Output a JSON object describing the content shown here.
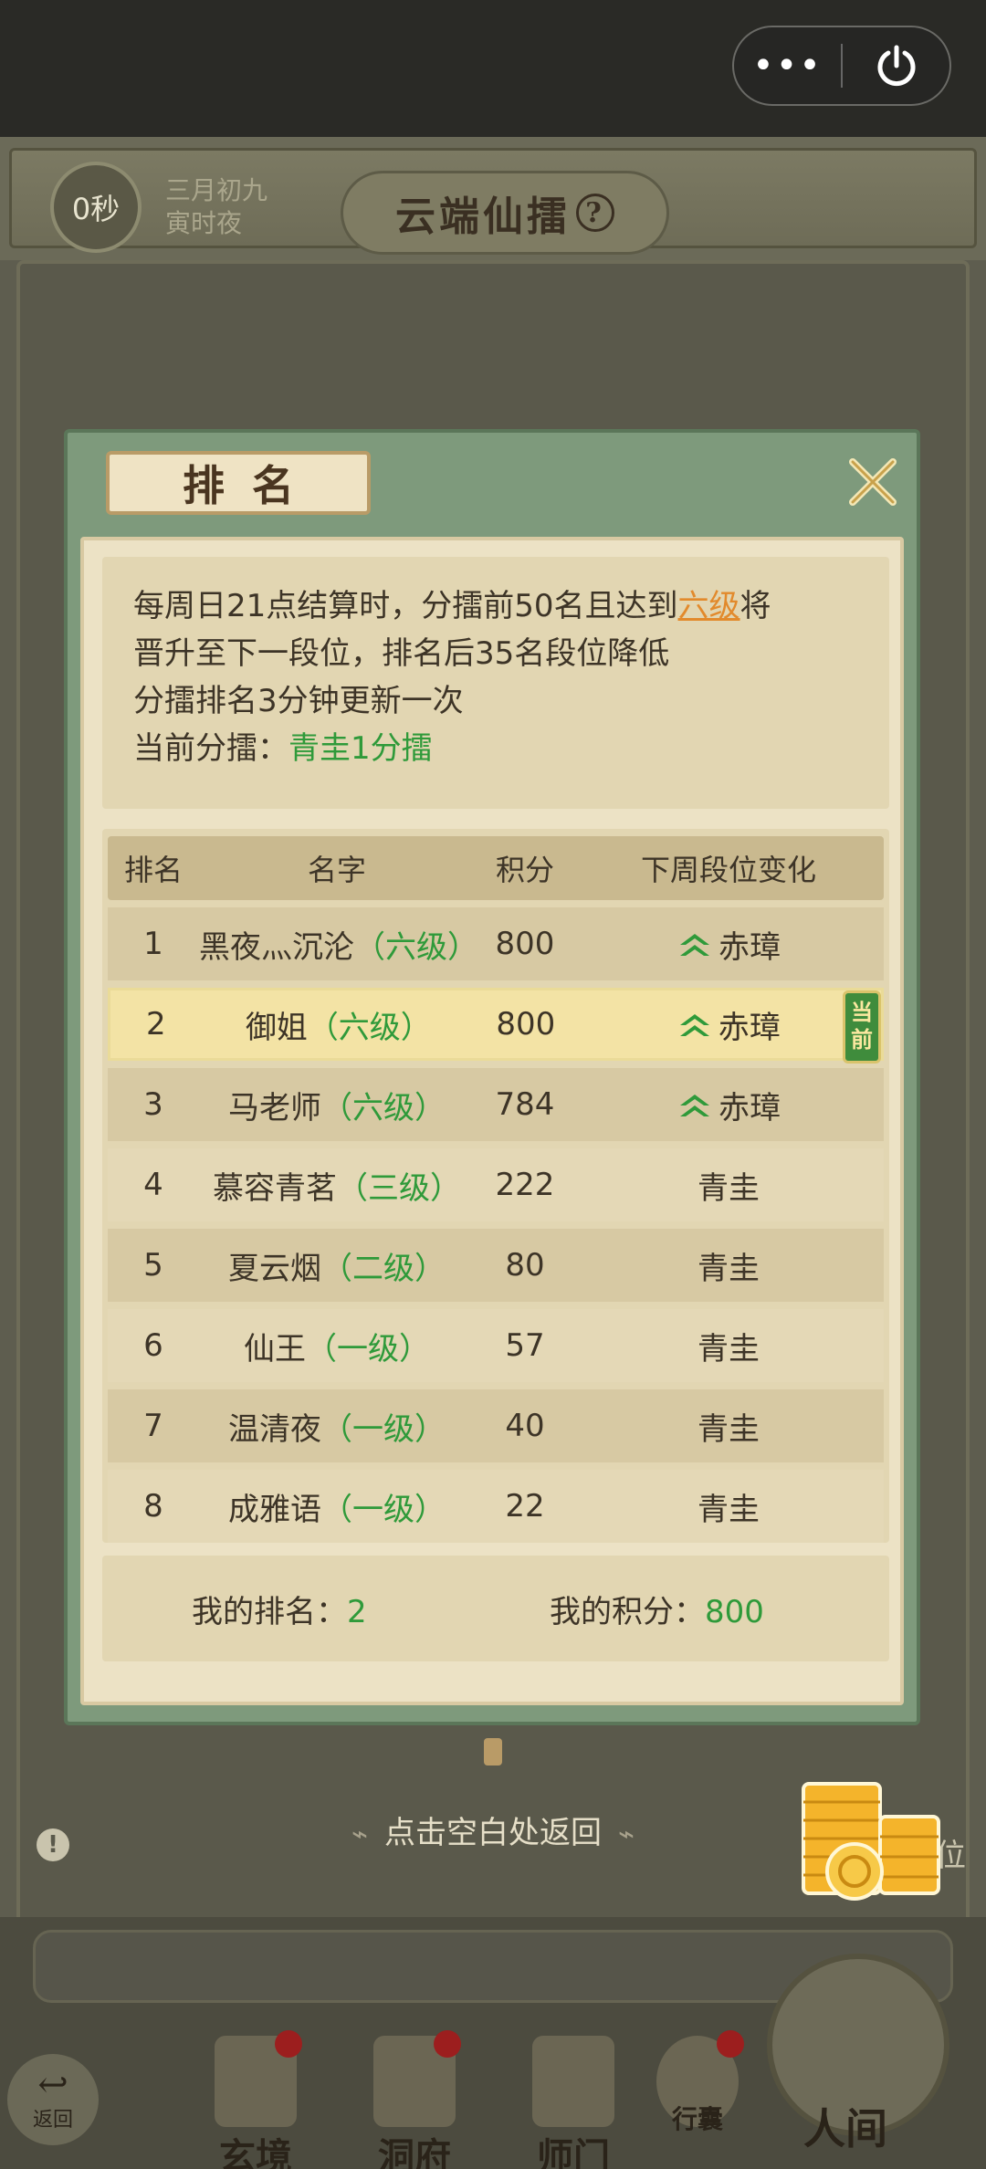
{
  "capsule": {
    "more_label": "•••"
  },
  "header": {
    "timer": "0秒",
    "date_line1": "三月初九",
    "date_line2": "寅时夜",
    "title": "云端仙擂",
    "help": "?"
  },
  "modal": {
    "title": "排名",
    "info": {
      "line1_pre": "每周日21点结算时，分擂前50名且达到",
      "line1_level": "六级",
      "line1_post": "将",
      "line2": "晋升至下一段位，排名后35名段位降低",
      "line3": "分擂排名3分钟更新一次",
      "current_label": "当前分擂：",
      "current_value": "青圭1分擂"
    },
    "table": {
      "headers": [
        "排名",
        "名字",
        "积分",
        "下周段位变化"
      ],
      "rows": [
        {
          "rank": "1",
          "name": "黑夜灬沉沦",
          "level": "（六级）",
          "score": "800",
          "change": "赤璋",
          "up": true
        },
        {
          "rank": "2",
          "name": "御姐",
          "level": "（六级）",
          "score": "800",
          "change": "赤璋",
          "up": true,
          "current": true
        },
        {
          "rank": "3",
          "name": "马老师",
          "level": "（六级）",
          "score": "784",
          "change": "赤璋",
          "up": true
        },
        {
          "rank": "4",
          "name": "慕容青茗",
          "level": "（三级）",
          "score": "222",
          "change": "青圭",
          "up": false
        },
        {
          "rank": "5",
          "name": "夏云烟",
          "level": "（二级）",
          "score": "80",
          "change": "青圭",
          "up": false
        },
        {
          "rank": "6",
          "name": "仙王",
          "level": "（一级）",
          "score": "57",
          "change": "青圭",
          "up": false
        },
        {
          "rank": "7",
          "name": "温清夜",
          "level": "（一级）",
          "score": "40",
          "change": "青圭",
          "up": false
        },
        {
          "rank": "8",
          "name": "成雅语",
          "level": "（一级）",
          "score": "22",
          "change": "青圭",
          "up": false
        }
      ],
      "current_badge": "当前"
    },
    "mine": {
      "rank_label": "我的排名：",
      "rank_value": "2",
      "score_label": "我的积分：",
      "score_value": "800"
    }
  },
  "tap_return": "点击空白处返回",
  "background": {
    "partial_text": "位",
    "warn": "!"
  },
  "nav": {
    "back": "返回",
    "items": [
      "玄境",
      "洞府",
      "师门",
      "行囊",
      "人间"
    ]
  },
  "colors": {
    "accent_green": "#2f9a3a",
    "level_orange": "#e28a2c",
    "modal_frame": "#7e9a7c",
    "parchment": "#ece2c5"
  }
}
